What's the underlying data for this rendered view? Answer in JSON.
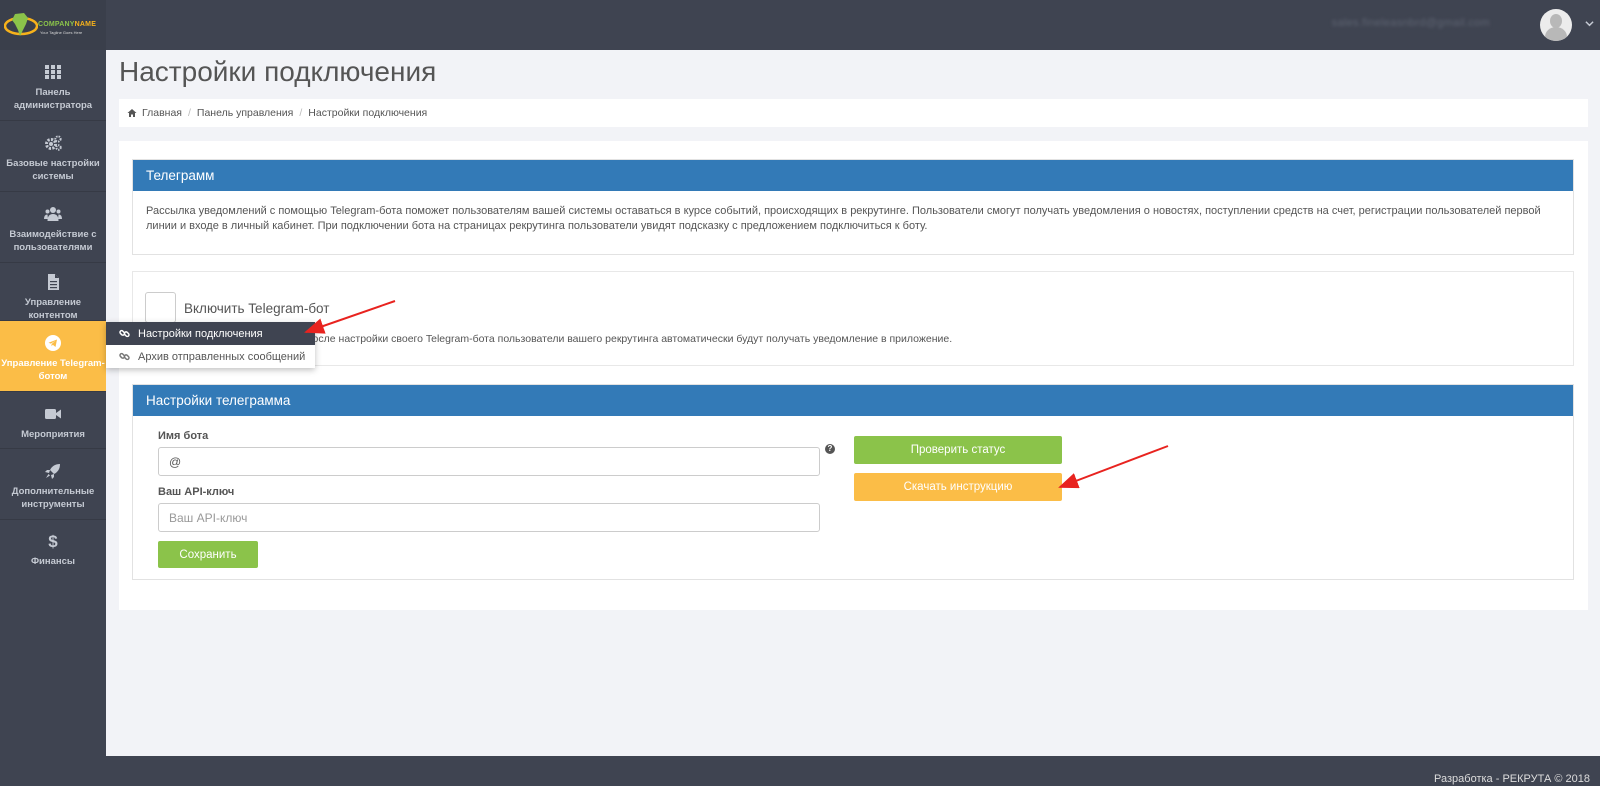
{
  "header": {
    "logo_company": "COMPANY",
    "logo_name": "NAME",
    "logo_tagline": "Your Tagline Goes Here",
    "user_email": "sales.fineleasnbrd@gmail.com"
  },
  "sidebar": {
    "items": [
      {
        "label": "Панель администратора",
        "icon": "grid-icon"
      },
      {
        "label": "Базовые настройки системы",
        "icon": "gears-icon"
      },
      {
        "label": "Взаимодействие с пользователями",
        "icon": "users-icon"
      },
      {
        "label": "Управление контентом",
        "icon": "file-icon"
      },
      {
        "label": "Управление Telegram-ботом",
        "icon": "telegram-icon"
      },
      {
        "label": "Мероприятия",
        "icon": "video-camera-icon"
      },
      {
        "label": "Дополнительные инструменты",
        "icon": "rocket-icon"
      },
      {
        "label": "Финансы",
        "icon": "dollar-icon"
      }
    ],
    "submenu": [
      {
        "label": "Настройки подключения",
        "icon": "link-icon",
        "active": true
      },
      {
        "label": "Архив отправленных сообщений",
        "icon": "link-icon",
        "active": false
      }
    ]
  },
  "page": {
    "title": "Настройки подключения",
    "breadcrumb": [
      "Главная",
      "Панель управления",
      "Настройки подключения"
    ]
  },
  "telegram_panel": {
    "title": "Телеграмм",
    "description": "Рассылка уведомлений с помощью Telegram-бота поможет пользователям вашей системы оставаться в курсе событий, происходящих в рекрутинге. Пользователи смогут получать уведомления о новостях, поступлении средств на счет, регистрации пользователей первой линии и входе в личный кабинет. При подключении бота на страницах рекрутинга пользователи увидят подсказку с предложением подключиться к боту."
  },
  "enable": {
    "label": "Включить Telegram-бот",
    "hint": "После настройки своего Telegram-бота пользователи вашего рекрутинга автоматически будут получать уведомление в приложение.",
    "checked": false
  },
  "settings_panel": {
    "title": "Настройки телеграмма",
    "bot_name_label": "Имя бота",
    "bot_name_value": "@",
    "api_key_label": "Ваш API-ключ",
    "api_key_placeholder": "Ваш API-ключ",
    "save_label": "Сохранить",
    "check_status_label": "Проверить статус",
    "download_label": "Скачать инструкцию"
  },
  "footer": {
    "text": "Разработка - РЕКРУТА © 2018"
  },
  "colors": {
    "panel_header": "#337ab7",
    "accent_yellow": "#fbbd47",
    "accent_green": "#8bc34a",
    "sidebar_bg": "#3f4451",
    "annotation_arrow": "#e8231f"
  }
}
